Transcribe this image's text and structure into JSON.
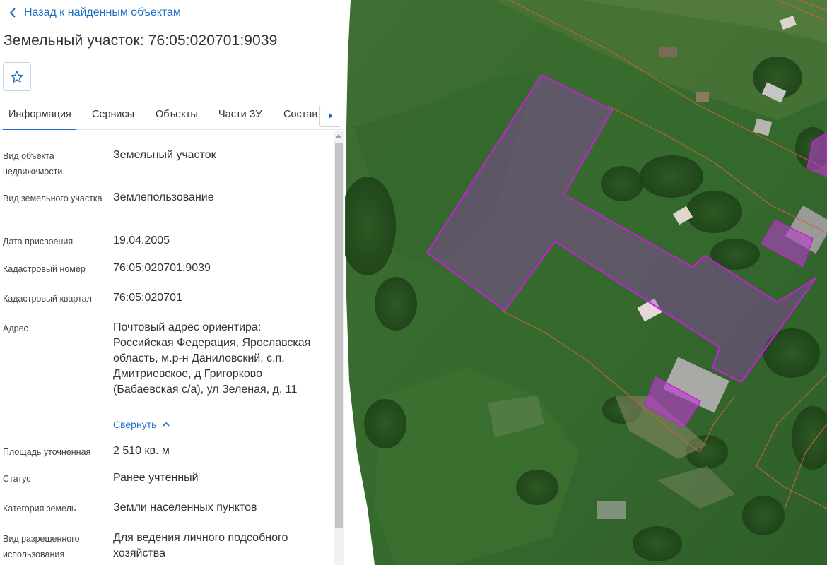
{
  "nav": {
    "back_label": "Назад к найденным объектам"
  },
  "header": {
    "title": "Земельный участок: 76:05:020701:9039"
  },
  "tabs": [
    {
      "label": "Информация",
      "active": true
    },
    {
      "label": "Сервисы"
    },
    {
      "label": "Объекты"
    },
    {
      "label": "Части ЗУ"
    },
    {
      "label": "Состав"
    }
  ],
  "properties": [
    {
      "label": "Вид объекта недвижимости",
      "value": "Земельный участок"
    },
    {
      "label": "Вид земельного участка",
      "value": "Землепользование"
    },
    {
      "label": "Дата присвоения",
      "value": "19.04.2005"
    },
    {
      "label": "Кадастровый номер",
      "value": "76:05:020701:9039"
    },
    {
      "label": "Кадастровый квартал",
      "value": "76:05:020701"
    },
    {
      "label": "Адрес",
      "value": "Почтовый адрес ориентира: Российская Федерация, Ярославская область, м.р-н Даниловский, с.п. Дмитриевское, д Григорково (Бабаевская с/а), ул Зеленая, д. 11"
    },
    {
      "label": "Площадь уточненная",
      "value": "2 510 кв. м"
    },
    {
      "label": "Статус",
      "value": "Ранее учтенный"
    },
    {
      "label": "Категория земель",
      "value": "Земли населенных пунктов"
    },
    {
      "label": "Вид разрешенного использования",
      "value": "Для ведения личного подсобного хозяйства"
    }
  ],
  "address_toggle": {
    "label": "Свернуть"
  },
  "icons": {
    "back": "chevron-left-icon",
    "favorite": "star-outline-icon",
    "tabs_next": "caret-right-icon",
    "collapse": "chevron-up-icon"
  },
  "colors": {
    "link": "#1a6fc4",
    "parcel_fill": "#a13bc4",
    "parcel_stroke": "#c71fd6",
    "boundary": "#c8643c"
  }
}
